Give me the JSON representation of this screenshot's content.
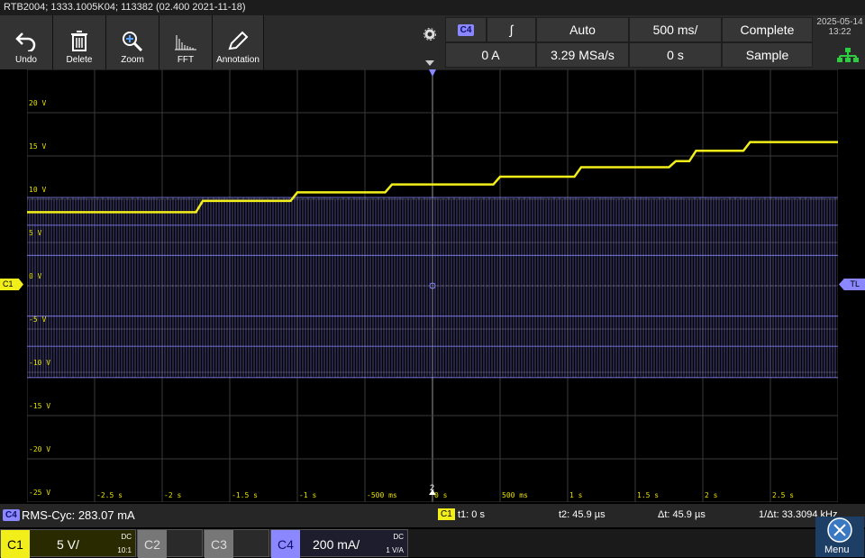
{
  "title": "RTB2004; 1333.1005K04; 113382 (02.400 2021-11-18)",
  "toolbar": [
    {
      "label": "Undo",
      "icon": "undo-icon"
    },
    {
      "label": "Delete",
      "icon": "trash-icon"
    },
    {
      "label": "Zoom",
      "icon": "zoom-icon"
    },
    {
      "label": "FFT",
      "icon": "fft-icon"
    },
    {
      "label": "Annotation",
      "icon": "pen-icon"
    }
  ],
  "trigger": {
    "source": "C4",
    "slope_symbol": "∫",
    "mode": "Auto",
    "level": "0 A",
    "timebase": "500 ms/",
    "sample_rate": "3.29 MSa/s",
    "position": "0 s",
    "acq_state": "Complete",
    "acq_mode": "Sample"
  },
  "clock": {
    "date": "2025-05-14",
    "time": "13:22"
  },
  "grid": {
    "y_labels": [
      "20 V",
      "15 V",
      "10 V",
      "5 V",
      "0 V",
      "-5 V",
      "-10 V",
      "-15 V",
      "-20 V",
      "-25 V"
    ],
    "x_labels": [
      "-2.5 s",
      "-2 s",
      "-1.5 s",
      "-1 s",
      "-500 ms",
      "0 s",
      "500 ms",
      "1 s",
      "1.5 s",
      "2 s",
      "2.5 s"
    ],
    "left_marker": "C1",
    "right_marker": "TL",
    "bottom_marker": "2"
  },
  "chart_data": {
    "type": "line",
    "x_unit": "s",
    "xlim": [
      -3,
      3
    ],
    "ylim": [
      -25,
      25
    ],
    "series": [
      {
        "color": "#f2ee1a",
        "x": [
          -3.0,
          -1.75,
          -1.7,
          -1.05,
          -1.0,
          -0.35,
          -0.3,
          0.45,
          0.5,
          1.05,
          1.1,
          1.75,
          1.8,
          1.9,
          1.95,
          2.3,
          2.35,
          3.0
        ],
        "y": [
          8.5,
          8.5,
          9.8,
          9.8,
          10.8,
          10.8,
          11.7,
          11.7,
          12.6,
          12.6,
          13.7,
          13.7,
          14.4,
          14.4,
          15.6,
          15.6,
          16.6,
          16.6
        ]
      },
      {
        "color": "#8b87ff",
        "pattern": "dense oscillation",
        "y_min": -10.6,
        "y_max": 10.2
      }
    ]
  },
  "status": {
    "measure_chan": "C4",
    "measure": "RMS-Cyc: 283.07 mA",
    "cursor_chan": "C1",
    "t1": "t1: 0 s",
    "t2": "t2: 45.9 µs",
    "dt": "Δt: 45.9 µs",
    "inv_dt": "1/Δt: 33.3094 kHz"
  },
  "channels": [
    {
      "name": "C1",
      "value": "5 V/",
      "coupling": "DC",
      "sub": "10:1",
      "color": "#f2ee1a"
    },
    {
      "name": "C2",
      "value": "",
      "coupling": "",
      "sub": "",
      "color": "#999"
    },
    {
      "name": "C3",
      "value": "",
      "coupling": "",
      "sub": "",
      "color": "#999"
    },
    {
      "name": "C4",
      "value": "200 mA/",
      "coupling": "DC",
      "sub": "1 V/A",
      "color": "#8b87ff"
    }
  ],
  "menu_label": "Menu"
}
